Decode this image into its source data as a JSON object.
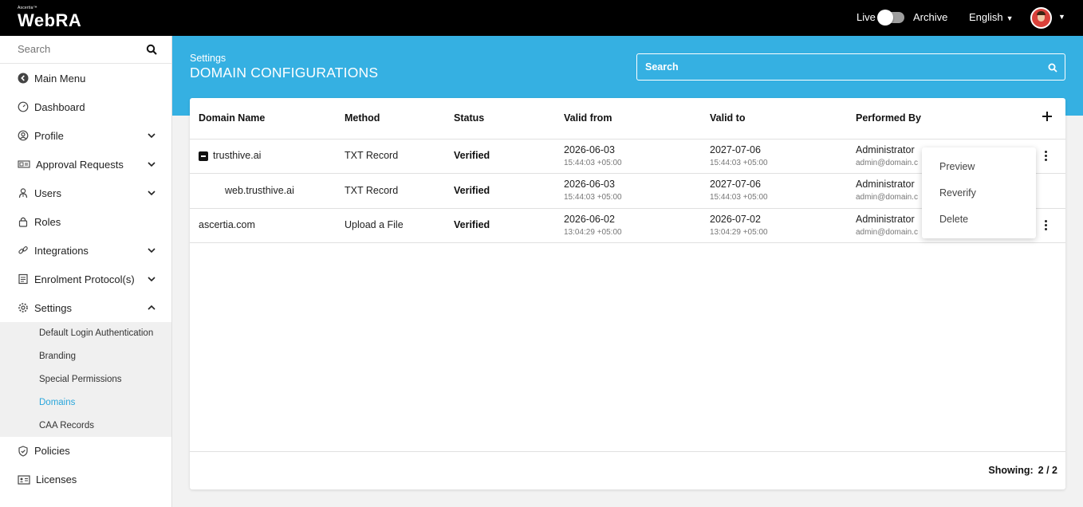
{
  "app": {
    "brand_small": "Ascertia™",
    "brand_name": "WebRA"
  },
  "topbar": {
    "live_label": "Live",
    "archive_label": "Archive",
    "language": "English"
  },
  "sidebar": {
    "search_placeholder": "Search",
    "items": [
      {
        "label": "Main Menu"
      },
      {
        "label": "Dashboard"
      },
      {
        "label": "Profile"
      },
      {
        "label": "Approval Requests"
      },
      {
        "label": "Users"
      },
      {
        "label": "Roles"
      },
      {
        "label": "Integrations"
      },
      {
        "label": "Enrolment Protocol(s)"
      },
      {
        "label": "Settings"
      },
      {
        "label": "Policies"
      },
      {
        "label": "Licenses"
      }
    ],
    "settings_sub": [
      {
        "label": "Default Login Authentication"
      },
      {
        "label": "Branding"
      },
      {
        "label": "Special Permissions"
      },
      {
        "label": "Domains"
      },
      {
        "label": "CAA Records"
      }
    ]
  },
  "header": {
    "breadcrumb": "Settings",
    "title": "DOMAIN CONFIGURATIONS",
    "search_placeholder": "Search"
  },
  "table": {
    "columns": [
      "Domain Name",
      "Method",
      "Status",
      "Valid from",
      "Valid to",
      "Performed By"
    ],
    "rows": [
      {
        "domain": "trusthive.ai",
        "method": "TXT Record",
        "status": "Verified",
        "valid_from_date": "2026-06-03",
        "valid_from_time": "15:44:03 +05:00",
        "valid_to_date": "2027-07-06",
        "valid_to_time": "15:44:03 +05:00",
        "by_name": "Administrator",
        "by_email": "admin@domain.c"
      },
      {
        "domain": "web.trusthive.ai",
        "method": "TXT Record",
        "status": "Verified",
        "valid_from_date": "2026-06-03",
        "valid_from_time": "15:44:03 +05:00",
        "valid_to_date": "2027-07-06",
        "valid_to_time": "15:44:03 +05:00",
        "by_name": "Administrator",
        "by_email": "admin@domain.c"
      },
      {
        "domain": "ascertia.com",
        "method": "Upload a File",
        "status": "Verified",
        "valid_from_date": "2026-06-02",
        "valid_from_time": "13:04:29 +05:00",
        "valid_to_date": "2026-07-02",
        "valid_to_time": "13:04:29 +05:00",
        "by_name": "Administrator",
        "by_email": "admin@domain.c"
      }
    ]
  },
  "context_menu": {
    "items": [
      "Preview",
      "Reverify",
      "Delete"
    ]
  },
  "footer": {
    "showing_label": "Showing:",
    "showing_value": "2 / 2"
  },
  "colors": {
    "accent": "#35b0e2",
    "topbar": "#000000",
    "active_link": "#2aa6db"
  }
}
